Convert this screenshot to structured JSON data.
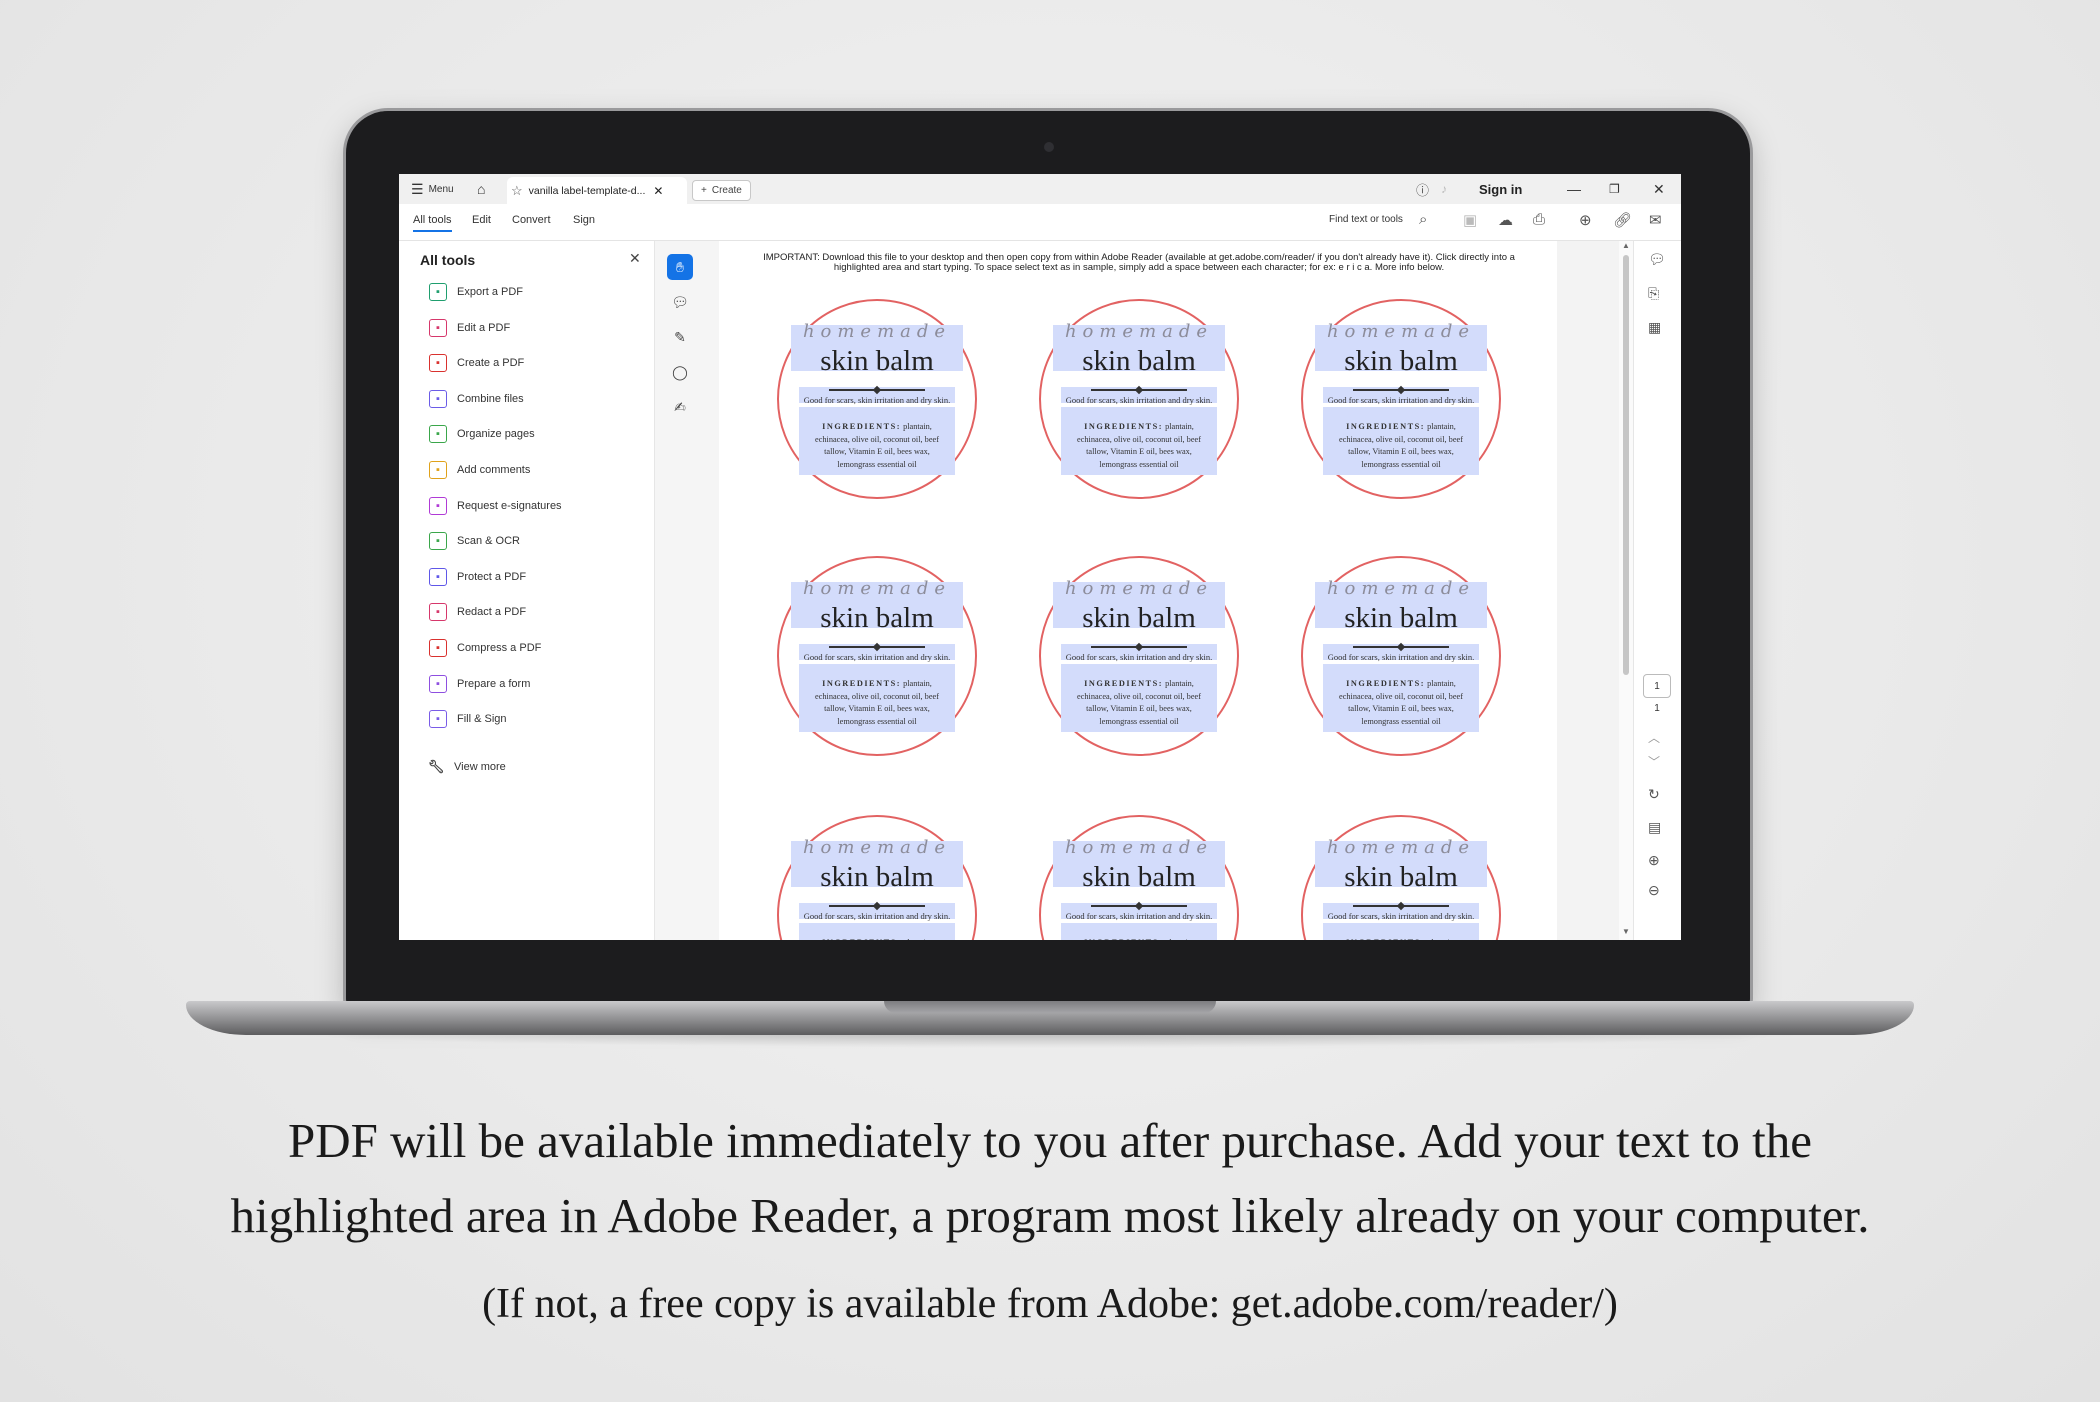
{
  "app": {
    "menu_label": "Menu",
    "tab_title": "vanilla label-template-d...",
    "create_label": "Create",
    "sign_in": "Sign in"
  },
  "menubar": {
    "tabs": [
      "All tools",
      "Edit",
      "Convert",
      "Sign"
    ],
    "search_label": "Find text or tools"
  },
  "tools_panel": {
    "title": "All tools",
    "items": [
      {
        "label": "Export a PDF",
        "color": "#1f9e6e"
      },
      {
        "label": "Edit a PDF",
        "color": "#d6376b"
      },
      {
        "label": "Create a PDF",
        "color": "#d9312e"
      },
      {
        "label": "Combine files",
        "color": "#6b5ce7"
      },
      {
        "label": "Organize pages",
        "color": "#3aa64a"
      },
      {
        "label": "Add comments",
        "color": "#e0a21b"
      },
      {
        "label": "Request e-signatures",
        "color": "#b03ad6"
      },
      {
        "label": "Scan & OCR",
        "color": "#3aa64a"
      },
      {
        "label": "Protect a PDF",
        "color": "#5f57e8"
      },
      {
        "label": "Redact a PDF",
        "color": "#d6376b"
      },
      {
        "label": "Compress a PDF",
        "color": "#d9312e"
      },
      {
        "label": "Prepare a form",
        "color": "#8e4fe0"
      },
      {
        "label": "Fill & Sign",
        "color": "#7a5ce7"
      }
    ],
    "view_more": "View more"
  },
  "document": {
    "notice": "IMPORTANT: Download this file to your desktop and then open copy from within Adobe Reader (available at get.adobe.com/reader/ if you don't already have it). Click directly into a highlighted area and start typing. To space select text as in sample, simply add a space between each character; for ex: e r i c a. More info below.",
    "label_script": "homemade",
    "label_product": "skin balm",
    "label_desc": "Good for scars, skin irritation and dry skin.",
    "label_ingredients_heading": "INGREDIENTS:",
    "label_ingredients": "plantain, echinacea, olive oil, coconut oil, beef tallow, Vitamin E oil, bees wax, lemongrass essential oil"
  },
  "pager": {
    "current": "1",
    "total": "1"
  },
  "captions": {
    "line1": "PDF will be available immediately to you after purchase.  Add your text to the",
    "line2": "highlighted area in Adobe Reader, a program most likely already on your computer.",
    "line3": "(If not, a free copy is available from Adobe: get.adobe.com/reader/)"
  }
}
